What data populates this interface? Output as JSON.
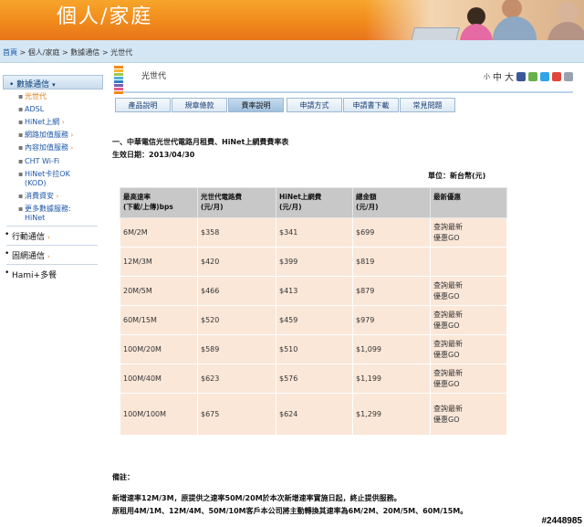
{
  "banner": {
    "title": "個人/家庭"
  },
  "breadcrumb": {
    "home": "首頁",
    "sep": " > ",
    "items": [
      "個人/家庭",
      "數據通信",
      "光世代"
    ]
  },
  "sidebar": {
    "section_data": "數據通信",
    "data_items": [
      {
        "label": "光世代",
        "active": true,
        "arrow": ""
      },
      {
        "label": "ADSL",
        "active": false,
        "arrow": ""
      },
      {
        "label": "HiNet上網",
        "active": false,
        "arrow": "›"
      },
      {
        "label": "網路加值服務",
        "active": false,
        "arrow": "›"
      },
      {
        "label": "內容加值服務",
        "active": false,
        "arrow": "›"
      },
      {
        "label": "CHT Wi-Fi",
        "active": false,
        "arrow": ""
      },
      {
        "label": "HiNet卡拉OK",
        "label2": "(KOD)",
        "active": false,
        "arrow": ""
      },
      {
        "label": "消費資安",
        "active": false,
        "arrow": "›"
      },
      {
        "label": "更多數據服務:",
        "label2": "HiNet",
        "active": false,
        "arrow": ""
      }
    ],
    "groups": [
      {
        "label": "行動通信"
      },
      {
        "label": "固網通信"
      },
      {
        "label": "Hami+多餐"
      }
    ]
  },
  "header": {
    "title": "光世代",
    "font_small": "小",
    "font_mid": "中",
    "font_large": "大"
  },
  "tabs": [
    {
      "label": "產品說明",
      "active": false
    },
    {
      "label": "規章條款",
      "active": false
    },
    {
      "label": "費率說明",
      "active": true
    },
    {
      "label": "申請方式",
      "active": false
    },
    {
      "label": "申請書下載",
      "active": false
    },
    {
      "label": "常見問題",
      "active": false
    }
  ],
  "content": {
    "heading": "一、中華電信光世代電路月租費、HiNet上網費費率表",
    "effective_date": "生效日期：2013/04/30",
    "unit": "單位：新台幣(元)"
  },
  "table": {
    "headers": [
      {
        "line1": "最高速率",
        "line2": "(下載/上傳)bps"
      },
      {
        "line1": "光世代電路費",
        "line2": "(元/月)"
      },
      {
        "line1": "HiNet上網費",
        "line2": "(元/月)"
      },
      {
        "line1": "總金額",
        "line2": "(元/月)"
      },
      {
        "line1": "最新優惠",
        "line2": ""
      }
    ],
    "rows": [
      {
        "speed": "6M/2M",
        "circuit": "$358",
        "hinet": "$341",
        "total": "$699",
        "promo1": "查詢最新",
        "promo2": "優惠GO"
      },
      {
        "speed": "12M/3M",
        "circuit": "$420",
        "hinet": "$399",
        "total": "$819",
        "promo1": "",
        "promo2": ""
      },
      {
        "speed": "20M/5M",
        "circuit": "$466",
        "hinet": "$413",
        "total": "$879",
        "promo1": "查詢最新",
        "promo2": "優惠GO"
      },
      {
        "speed": "60M/15M",
        "circuit": "$520",
        "hinet": "$459",
        "total": "$979",
        "promo1": "查詢最新",
        "promo2": "優惠GO"
      },
      {
        "speed": "100M/20M",
        "circuit": "$589",
        "hinet": "$510",
        "total": "$1,099",
        "promo1": "查詢最新",
        "promo2": "優惠GO"
      },
      {
        "speed": "100M/40M",
        "circuit": "$623",
        "hinet": "$576",
        "total": "$1,199",
        "promo1": "查詢最新",
        "promo2": "優惠GO"
      },
      {
        "speed": "100M/100M",
        "circuit": "$675",
        "hinet": "$624",
        "total": "$1,299",
        "promo1": "查詢最新",
        "promo2": "優惠GO"
      }
    ]
  },
  "notes": {
    "title": "備註：",
    "lines": [
      "新增速率12M/3M，原提供之速率50M/20M於本次新增速率實施日起，終止提供服務。",
      "原租用4M/1M、12M/4M、50M/10M客戶本公司將主動轉換其速率為6M/2M、20M/5M、60M/15M。"
    ]
  },
  "watermark": "#2448985",
  "colors": {
    "banner": "#f08a1c",
    "header_bg": "#c8c8c8",
    "row_bg": "#fbe7d8",
    "accent": "#e07a10"
  }
}
